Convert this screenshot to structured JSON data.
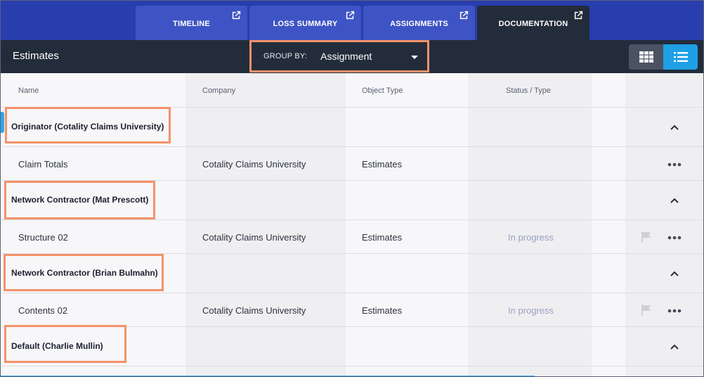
{
  "tabs": [
    {
      "label": "TIMELINE",
      "active": false
    },
    {
      "label": "LOSS SUMMARY",
      "active": false
    },
    {
      "label": "ASSIGNMENTS",
      "active": false
    },
    {
      "label": "DOCUMENTATION",
      "active": true
    }
  ],
  "header": {
    "title": "Estimates",
    "group_by_label": "GROUP BY:",
    "group_by_value": "Assignment",
    "view_modes": [
      "grid-icon",
      "list-icon"
    ],
    "active_view": "list-icon"
  },
  "table": {
    "columns": [
      "Name",
      "Company",
      "Object Type",
      "Status / Type"
    ],
    "groups": [
      {
        "label": "Originator (Cotality Claims University)",
        "rows": [
          {
            "name": "Claim Totals",
            "company": "Cotality Claims University",
            "object_type": "Estimates",
            "status": "",
            "flag": false
          }
        ]
      },
      {
        "label": "Network Contractor (Mat Prescott)",
        "rows": [
          {
            "name": "Structure 02",
            "company": "Cotality Claims University",
            "object_type": "Estimates",
            "status": "In progress",
            "flag": true
          }
        ]
      },
      {
        "label": "Network Contractor (Brian Bulmahn)",
        "rows": [
          {
            "name": "Contents 02",
            "company": "Cotality Claims University",
            "object_type": "Estimates",
            "status": "In progress",
            "flag": true
          }
        ]
      },
      {
        "label": "Default (Charlie Mullin)",
        "rows": []
      }
    ]
  },
  "colors": {
    "tab_bar": "#283dae",
    "tab": "#3e54c4",
    "header": "#232c3a",
    "highlight": "#f4926a",
    "accent": "#1fa0e6"
  }
}
